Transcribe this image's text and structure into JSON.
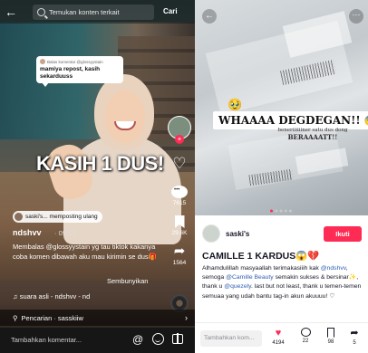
{
  "left": {
    "search": {
      "placeholder": "Temukan konten terkait",
      "button": "Cari"
    },
    "reply": {
      "header": "Balas komentar @glossyystain",
      "text": "mamiya repost, kasih sekarduuss"
    },
    "big_caption": "KASIH 1 DUS!",
    "rail": {
      "comment_count": "7615",
      "bookmark_count": "29.6K",
      "share_count": "1564"
    },
    "repost": "saski's... memposting ulang",
    "username": "ndshvv",
    "date": "· 09-21",
    "caption": "Membalas @glossyystain yg tau tiktok kakanya coba komen dibawah aku mau kirimin se dus🎁",
    "hide_label": "Sembunyikan",
    "sound": "♫ suara asli - ndshvv - nd",
    "search_bar": "Pencarian · sasskiiw",
    "comment_placeholder": "Tambahkan komentar..."
  },
  "right": {
    "overlay_main": "WHAAAA DEGDEGAN!!",
    "overlay_sub_1": "beneriiiiiiner satu dus dong",
    "overlay_sub_2": "BERAAAATT!!",
    "author": "saski's",
    "follow_label": "Ikuti",
    "title": "CAMILLE 1 KARDUS😱💔",
    "body_1": "Alhamdulillah masyaallah terimakasiiih kak ",
    "mention_1": "@ndshvv",
    "body_2": ", semoga ",
    "mention_2": "@Camille Beauty",
    "body_3": " semakin sukses & bersinar✨, thank u ",
    "mention_3": "@quezely",
    "body_4": ". last but not least, thank u temen-temen semuaa yang udah bantu tag-in akun akuuuu! ♡",
    "comment_placeholder": "Tambahkan kom...",
    "like_count": "4194",
    "comment_count": "22",
    "save_count": "98",
    "share_count": "5"
  },
  "colors": {
    "accent": "#fe2c55",
    "mention": "#2f5fb3"
  }
}
